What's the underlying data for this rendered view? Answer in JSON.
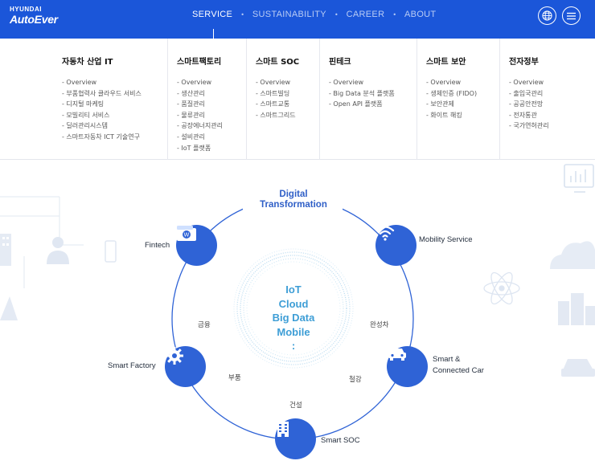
{
  "header": {
    "logo_top": "HYUNDAI",
    "logo_bottom": "AutoEver",
    "nav": [
      {
        "label": "SERVICE",
        "active": true
      },
      {
        "label": "SUSTAINABILITY",
        "active": false
      },
      {
        "label": "CAREER",
        "active": false
      },
      {
        "label": "ABOUT",
        "active": false
      }
    ],
    "globe_icon": "globe-icon",
    "menu_icon": "hamburger-icon"
  },
  "megamenu": [
    {
      "title": "자동차 산업 IT",
      "items": [
        "- Overview",
        "- 부품협력사 클라우드 서비스",
        "- 디지털 마케팅",
        "- 모빌리티 서비스",
        "- 딜러관리시스템",
        "- 스마트자동차 ICT 기술연구"
      ]
    },
    {
      "title": "스마트팩토리",
      "items": [
        "- Overview",
        "- 생산관리",
        "- 품질관리",
        "- 물류관리",
        "- 공장에너지관리",
        "- 설비관리",
        "- IoT 플랫폼"
      ]
    },
    {
      "title": "스마트 SOC",
      "items": [
        "- Overview",
        "- 스마트빌딩",
        "- 스마트교통",
        "- 스마트그리드"
      ]
    },
    {
      "title": "핀테크",
      "items": [
        "- Overview",
        "- Big Data 분석 플랫폼",
        "- Open API 플랫폼"
      ]
    },
    {
      "title": "스마트 보안",
      "items": [
        "- Overview",
        "- 생체인증 (FIDO)",
        "- 보안관제",
        "- 화이트 해킹"
      ]
    },
    {
      "title": "전자정부",
      "items": [
        "- Overview",
        "- 출입국관리",
        "- 공공안전망",
        "- 전자통관",
        "- 국가연허관리"
      ]
    }
  ],
  "diagram": {
    "title_line1": "Digital",
    "title_line2": "Transformation",
    "center": [
      "IoT",
      "Cloud",
      "Big Data",
      "Mobile",
      ":"
    ],
    "nodes": {
      "fintech": "Fintech",
      "mobility": "Mobility Service",
      "smart_factory": "Smart Factory",
      "smart_car_1": "Smart &",
      "smart_car_2": "Connected Car",
      "smart_soc": "Smart SOC"
    },
    "industries": {
      "finance": "금융",
      "vehicle": "완성차",
      "parts": "부품",
      "steel": "철강",
      "construction": "건설"
    },
    "colors": {
      "primary": "#1b56d9",
      "node": "#2f63d6",
      "light_icon": "#dde6f3"
    }
  }
}
